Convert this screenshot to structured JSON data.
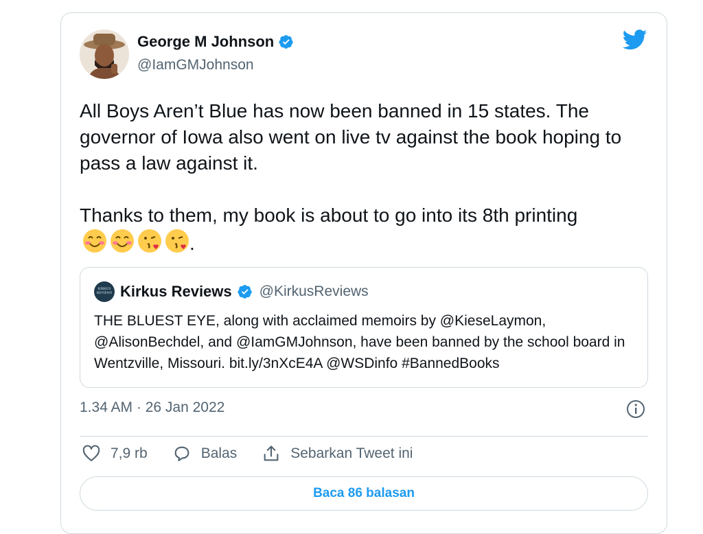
{
  "author": {
    "name": "George M Johnson",
    "handle": "@IamGMJohnson",
    "verified": true
  },
  "tweet": {
    "paragraph1": "All Boys Aren’t Blue has now been banned in 15 states. The governor of Iowa also went on live tv against the book hoping to pass a law against it.",
    "paragraph2": "Thanks to them, my book is about to go into its 8th printing",
    "emojis": [
      "smiling-face-with-blush",
      "smiling-face-with-blush",
      "face-blowing-kiss",
      "face-blowing-kiss"
    ],
    "trailing": "."
  },
  "quoted_tweet": {
    "name": "Kirkus Reviews",
    "handle": "@KirkusReviews",
    "avatar_text": "KIRKUS REVIEWS",
    "verified": true,
    "text": "THE BLUEST EYE, along with acclaimed memoirs by @KieseLaymon, @AlisonBechdel, and @IamGMJohnson, have been banned by the school board in Wentzville, Missouri. bit.ly/3nXcE4A @WSDinfo #BannedBooks"
  },
  "timestamp": "1.34 AM · 26 Jan 2022",
  "actions": {
    "like_count": "7,9 rb",
    "reply_label": "Balas",
    "share_label": "Sebarkan Tweet ini"
  },
  "read_replies_label": "Baca 86 balasan",
  "colors": {
    "accent": "#1d9bf0",
    "text": "#0f1419",
    "secondary": "#536471",
    "border": "#cfd9de"
  },
  "icons": [
    "twitter-bird-icon",
    "verified-badge-icon",
    "info-icon",
    "heart-icon",
    "reply-icon",
    "share-icon"
  ]
}
